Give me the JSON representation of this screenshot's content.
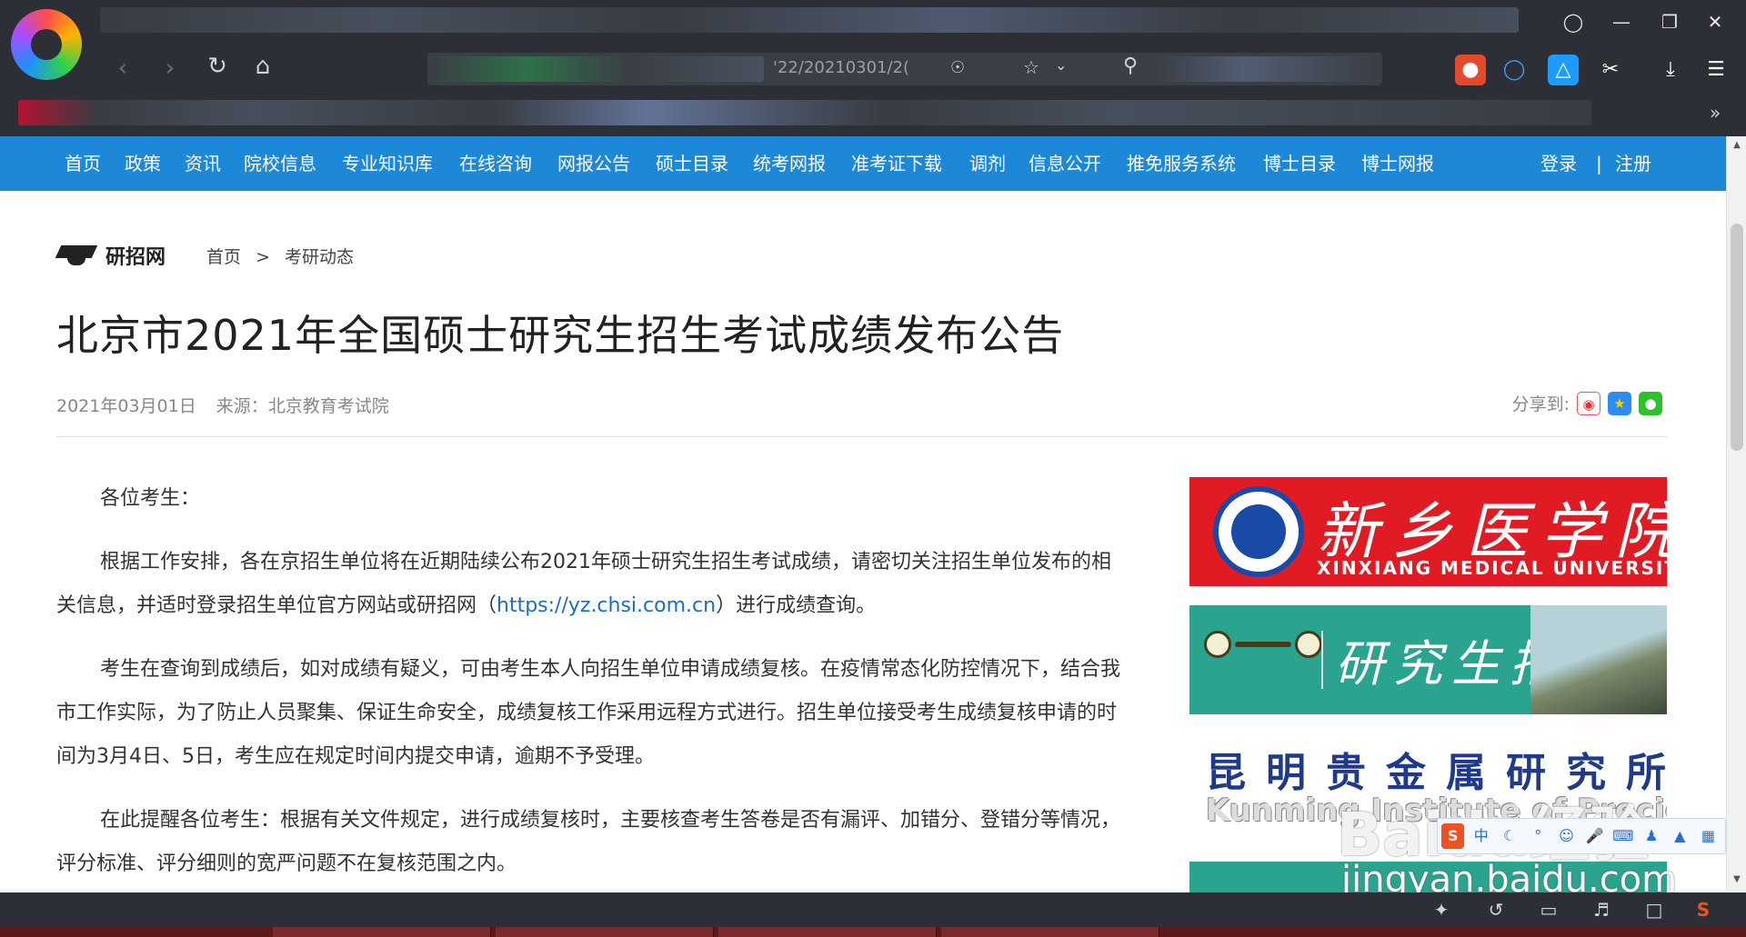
{
  "browser": {
    "url_fragment": "'22/20210301/2(",
    "window_controls": {
      "restore": "❐",
      "minimize": "—",
      "maximize": "❐",
      "close": "✕"
    },
    "nav_icons": [
      "back-icon",
      "forward-icon",
      "reload-icon",
      "home-icon"
    ],
    "more_label": "»",
    "colors": {
      "chrome": "#2c2f35"
    }
  },
  "nav": {
    "items": [
      "首页",
      "政策",
      "资讯",
      "院校信息",
      "专业知识库",
      "在线咨询",
      "网报公告",
      "硕士目录",
      "统考网报",
      "准考证下载",
      "调剂",
      "信息公开",
      "推免服务系统",
      "博士目录",
      "博士网报"
    ],
    "login": "登录",
    "separator": "|",
    "register": "注册",
    "color": "#1e88d8"
  },
  "header": {
    "site_name": "研招网",
    "breadcrumb": {
      "home": "首页",
      "sep": ">",
      "current": "考研动态"
    }
  },
  "article": {
    "title": "北京市2021年全国硕士研究生招生考试成绩发布公告",
    "date": "2021年03月01日",
    "source": "来源：北京教育考试院",
    "share_label": "分享到:",
    "greeting": "各位考生：",
    "p1_a": "根据工作安排，各在京招生单位将在近期陆续公布2021年硕士研究生招生考试成绩，请密切关注招生单位发布的相关信息，并适时登录招生单位官方网站或研招网（",
    "p1_link": "https://yz.chsi.com.cn",
    "p1_b": "）进行成绩查询。",
    "p2": "考生在查询到成绩后，如对成绩有疑义，可由考生本人向招生单位申请成绩复核。在疫情常态化防控情况下，结合我市工作实际，为了防止人员聚集、保证生命安全，成绩复核工作采用远程方式进行。招生单位接受考生成绩复核申请的时间为3月4日、5日，考生应在规定时间内提交申请，逾期不予受理。",
    "p3": "在此提醒各位考生：根据有关文件规定，进行成绩复核时，主要核查考生答卷是否有漏评、加错分、登错分等情况，评分标准、评分细则的宽严问题不在复核范围之内。"
  },
  "ads": {
    "ad1": {
      "cn": "新乡医学院",
      "en": "XINXIANG MEDICAL UNIVERSITY"
    },
    "ad2": {
      "text": "研究生招生"
    },
    "ad3": {
      "cn": "昆明贵金属研究所",
      "en": "Kunming Institute of Precious Metals"
    }
  },
  "watermark": {
    "brand": "Baidu经验",
    "url": "jingyan.baidu.com"
  }
}
